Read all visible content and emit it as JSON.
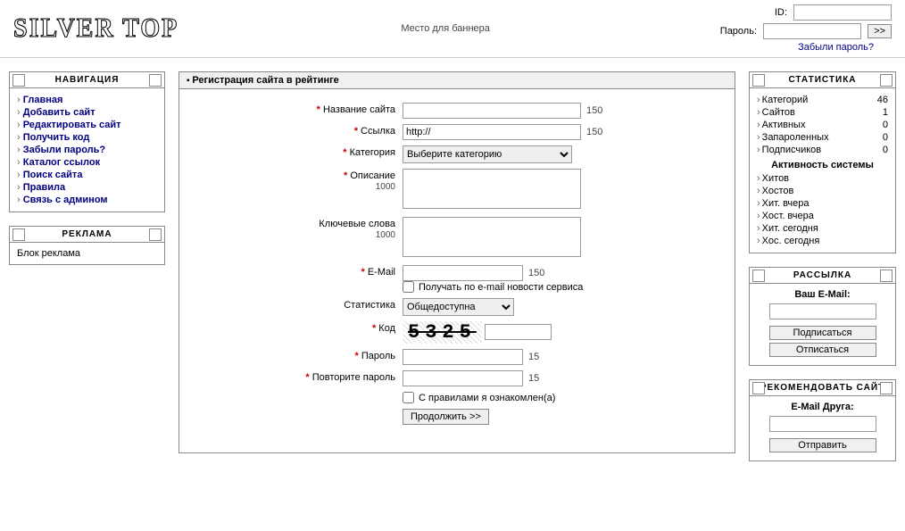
{
  "header": {
    "logo": "SILVER TOP",
    "banner": "Место для баннера",
    "login": {
      "id_label": "ID:",
      "pass_label": "Пароль:",
      "go": ">>",
      "forgot": "Забыли пароль?"
    }
  },
  "nav": {
    "title": "НАВИГАЦИЯ",
    "items": [
      "Главная",
      "Добавить сайт",
      "Редактировать сайт",
      "Получить код",
      "Забыли пароль?",
      "Каталог ссылок",
      "Поиск сайта",
      "Правила",
      "Связь с админом"
    ]
  },
  "ads": {
    "title": "РЕКЛАМА",
    "text": "Блок реклама"
  },
  "form": {
    "title": "Регистрация сайта в рейтинге",
    "name_label": "Название сайта",
    "name_hint": "150",
    "url_label": "Ссылка",
    "url_value": "http://",
    "url_hint": "150",
    "cat_label": "Категория",
    "cat_value": "Выберите категорию",
    "desc_label": "Описание",
    "desc_sub": "1000",
    "keys_label": "Ключевые слова",
    "keys_sub": "1000",
    "email_label": "E-Mail",
    "email_hint": "150",
    "news_label": "Получать по e-mail новости сервиса",
    "stat_label": "Статистика",
    "stat_value": "Общедоступна",
    "code_label": "Код",
    "code_value": "5325",
    "pass_label": "Пароль",
    "pass_hint": "15",
    "pass2_label": "Повторите пароль",
    "pass2_hint": "15",
    "rules_label": "С правилами я ознакомлен(а)",
    "submit": "Продолжить >>"
  },
  "stats": {
    "title": "СТАТИСТИКА",
    "rows": [
      {
        "k": "Категорий",
        "v": "46"
      },
      {
        "k": "Сайтов",
        "v": "1"
      },
      {
        "k": "Активных",
        "v": "0"
      },
      {
        "k": "Запароленных",
        "v": "0"
      },
      {
        "k": "Подписчиков",
        "v": "0"
      }
    ],
    "activity_title": "Активность системы",
    "activity": [
      {
        "k": "Хитов",
        "v": ""
      },
      {
        "k": "Хостов",
        "v": ""
      },
      {
        "k": "Хит. вчера",
        "v": ""
      },
      {
        "k": "Хост. вчера",
        "v": ""
      },
      {
        "k": "Хит. сегодня",
        "v": ""
      },
      {
        "k": "Хос. сегодня",
        "v": ""
      }
    ]
  },
  "subscribe": {
    "title": "РАССЫЛКА",
    "label": "Ваш E-Mail:",
    "sub_btn": "Подписаться",
    "unsub_btn": "Отписаться"
  },
  "recommend": {
    "title": "РЕКОМЕНДОВАТЬ САЙТ",
    "label": "E-Mail Друга:",
    "send_btn": "Отправить"
  }
}
